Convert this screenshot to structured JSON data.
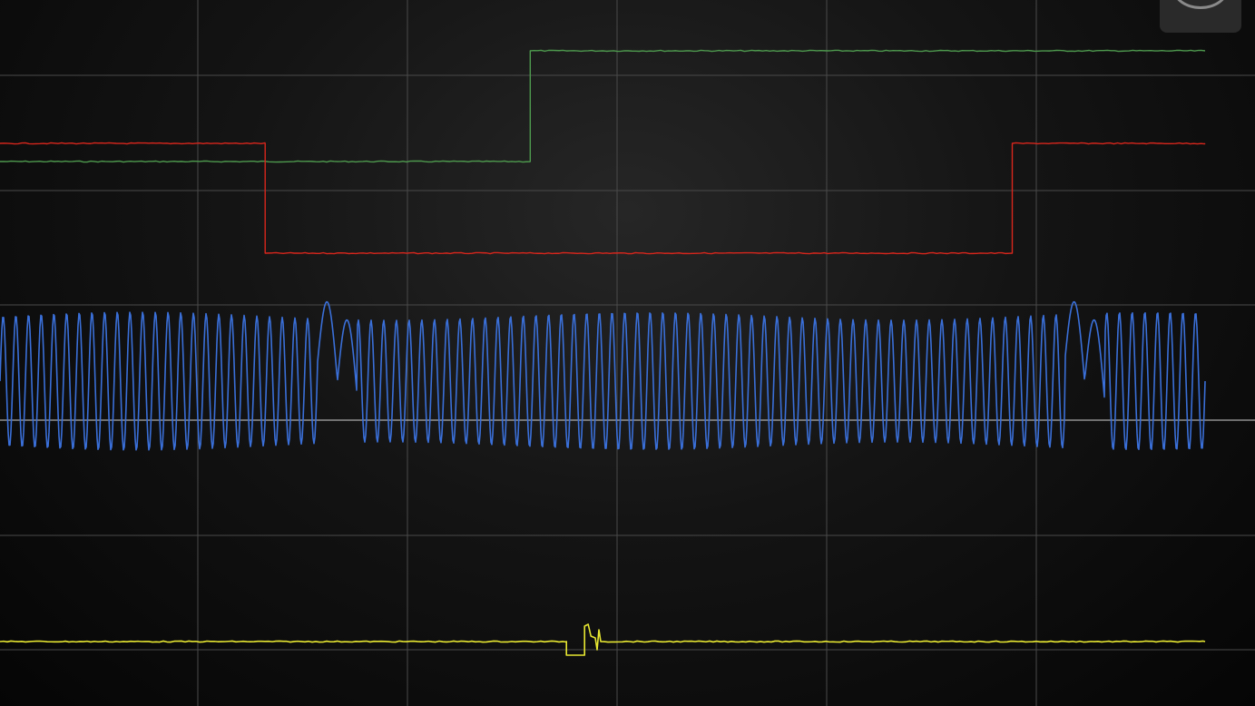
{
  "display": {
    "background": "#0a0a0a",
    "grid_color": "#4a4a4a",
    "center_line_color": "#d0d0d0",
    "grid": true,
    "divisions": {
      "x": 6,
      "y": 6
    }
  },
  "channels": [
    {
      "id": "green",
      "color": "#4e9a4e",
      "kind": "logic",
      "high_level": 1,
      "low_level": 0,
      "transitions": [
        {
          "x": 0.0,
          "level": 0
        },
        {
          "x": 0.44,
          "level": 1
        }
      ],
      "end": 1.0
    },
    {
      "id": "red",
      "color": "#d8261c",
      "kind": "logic",
      "high_level": 1,
      "low_level": 0,
      "transitions": [
        {
          "x": 0.0,
          "level": 1
        },
        {
          "x": 0.22,
          "level": 0
        },
        {
          "x": 0.84,
          "level": 1
        }
      ],
      "end": 1.0
    },
    {
      "id": "blue",
      "color": "#3a6fd8",
      "kind": "analog",
      "cycles": 95,
      "glitches": [
        0.28,
        0.9
      ],
      "end": 1.0
    },
    {
      "id": "yellow",
      "color": "#e8e832",
      "kind": "logic-pulse",
      "pulse": {
        "start": 0.47,
        "end": 0.497
      },
      "end": 1.0
    }
  ],
  "corner_button": {
    "icon": "circle-arrow-icon",
    "background": "#2a2a2a"
  }
}
